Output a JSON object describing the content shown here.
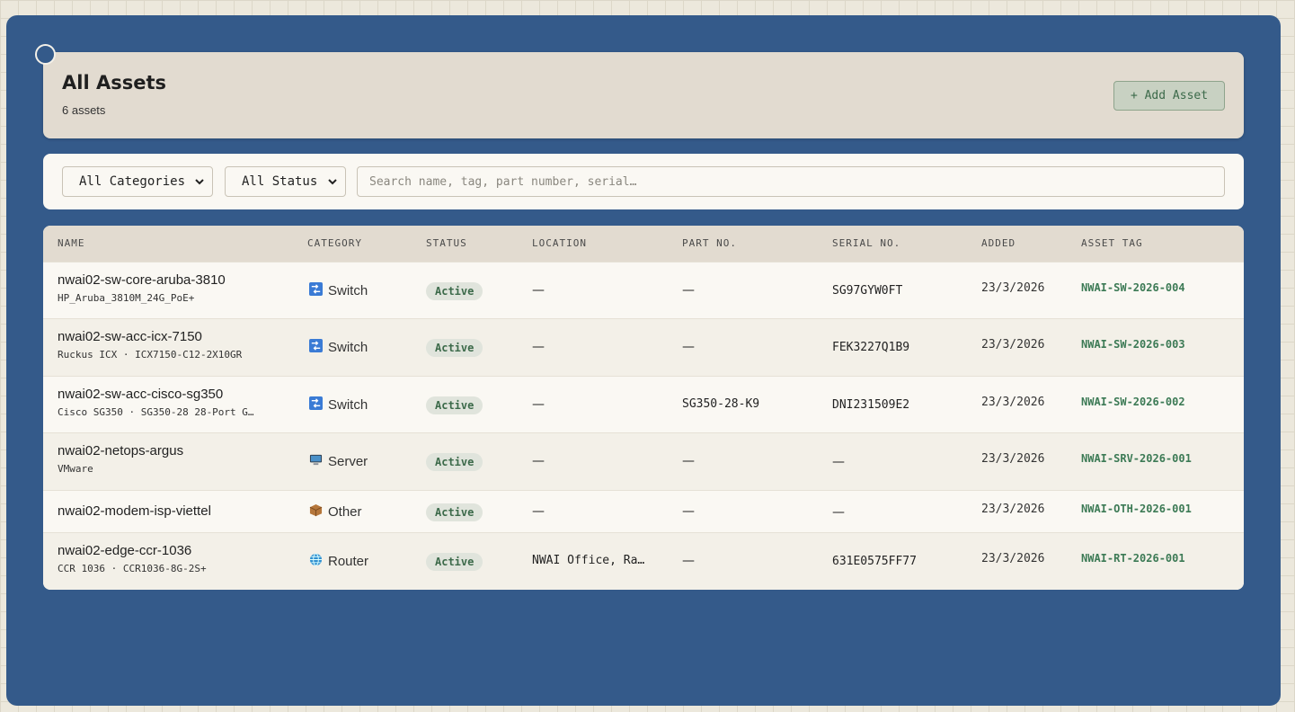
{
  "header": {
    "title": "All Assets",
    "count": "6 assets",
    "add_button": "+ Add Asset"
  },
  "filters": {
    "category": "All Categories",
    "status": "All Status",
    "search_placeholder": "Search name, tag, part number, serial…"
  },
  "table": {
    "columns": [
      "NAME",
      "CATEGORY",
      "STATUS",
      "LOCATION",
      "PART NO.",
      "SERIAL NO.",
      "ADDED",
      "ASSET TAG"
    ],
    "rows": [
      {
        "name": "nwai02-sw-core-aruba-3810",
        "sub": "HP_Aruba_3810M_24G_PoE+",
        "category": "Switch",
        "category_icon": "switch-icon",
        "status": "Active",
        "location": "—",
        "part_no": "—",
        "serial": "SG97GYW0FT",
        "added": "23/3/2026",
        "tag": "NWAI-SW-2026-004"
      },
      {
        "name": "nwai02-sw-acc-icx-7150",
        "sub": "Ruckus ICX · ICX7150-C12-2X10GR",
        "category": "Switch",
        "category_icon": "switch-icon",
        "status": "Active",
        "location": "—",
        "part_no": "—",
        "serial": "FEK3227Q1B9",
        "added": "23/3/2026",
        "tag": "NWAI-SW-2026-003"
      },
      {
        "name": "nwai02-sw-acc-cisco-sg350",
        "sub": "Cisco SG350 · SG350-28 28-Port G…",
        "category": "Switch",
        "category_icon": "switch-icon",
        "status": "Active",
        "location": "—",
        "part_no": "SG350-28-K9",
        "serial": "DNI231509E2",
        "added": "23/3/2026",
        "tag": "NWAI-SW-2026-002"
      },
      {
        "name": "nwai02-netops-argus",
        "sub": "VMware",
        "category": "Server",
        "category_icon": "server-icon",
        "status": "Active",
        "location": "—",
        "part_no": "—",
        "serial": "—",
        "added": "23/3/2026",
        "tag": "NWAI-SRV-2026-001"
      },
      {
        "name": "nwai02-modem-isp-viettel",
        "sub": "",
        "category": "Other",
        "category_icon": "package-icon",
        "status": "Active",
        "location": "—",
        "part_no": "—",
        "serial": "—",
        "added": "23/3/2026",
        "tag": "NWAI-OTH-2026-001"
      },
      {
        "name": "nwai02-edge-ccr-1036",
        "sub": "CCR 1036 · CCR1036-8G-2S+",
        "category": "Router",
        "category_icon": "globe-icon",
        "status": "Active",
        "location": "NWAI Office, Ra…",
        "part_no": "—",
        "serial": "631E0575FF77",
        "added": "23/3/2026",
        "tag": "NWAI-RT-2026-001"
      }
    ]
  },
  "colors": {
    "frame": "#345a8a",
    "card": "#e2dbd0",
    "accent_green": "#3c7a55",
    "switch_icon": "#3a7bd5",
    "server_icon": "#4a90c8",
    "package_icon": "#b5763a",
    "globe_icon": "#2f8fd0"
  }
}
